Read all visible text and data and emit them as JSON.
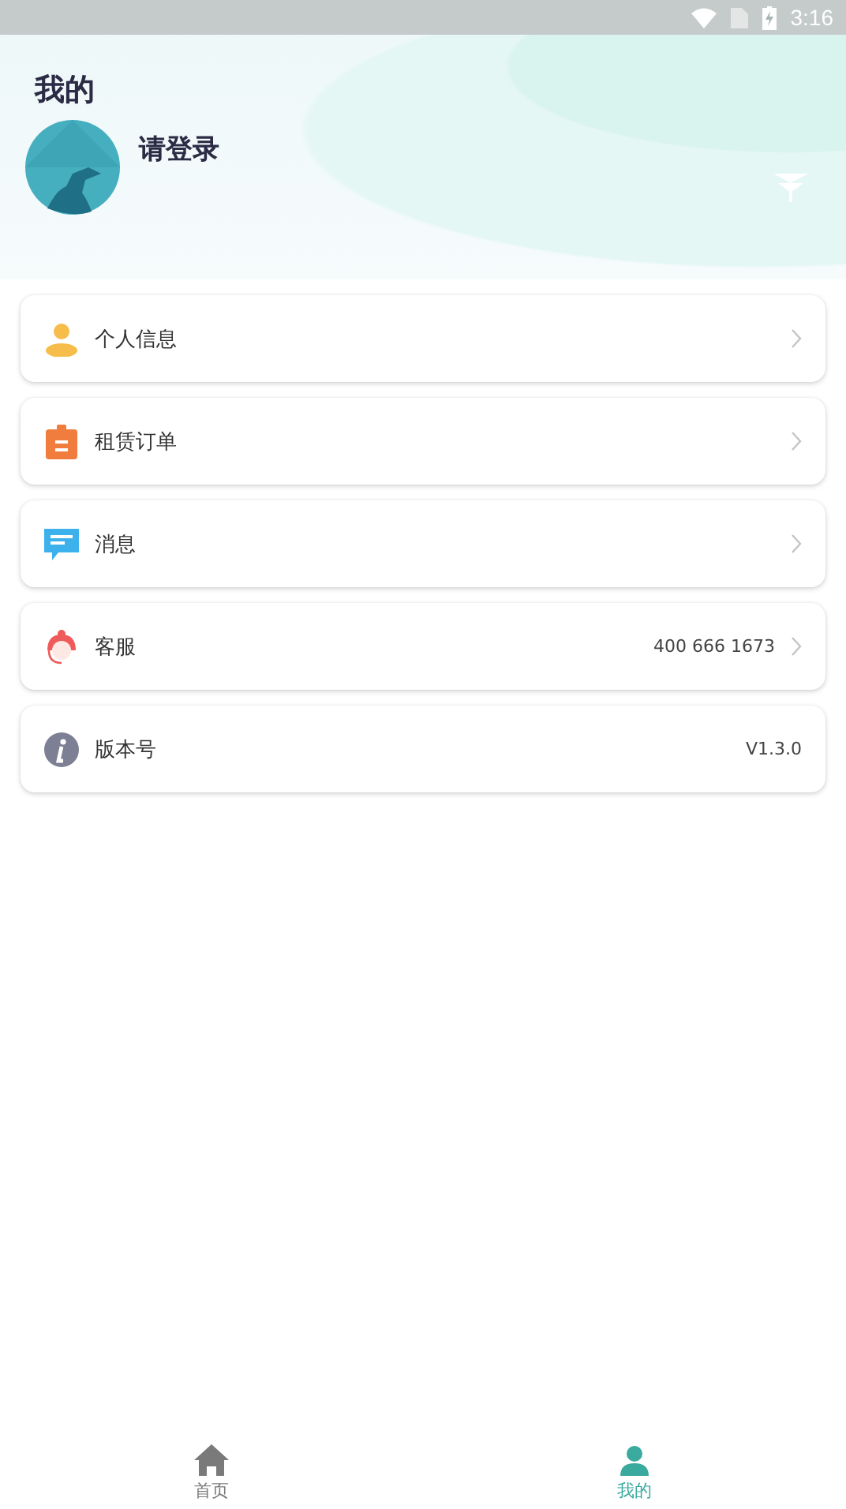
{
  "status_bar": {
    "time": "3:16"
  },
  "header": {
    "title": "我的",
    "login_prompt": "请登录"
  },
  "menu": [
    {
      "kind": "person",
      "label": "个人信息",
      "chevron": true
    },
    {
      "kind": "clipboard",
      "label": "租赁订单",
      "chevron": true
    },
    {
      "kind": "chat",
      "label": "消息",
      "chevron": true
    },
    {
      "kind": "agent",
      "label": "客服",
      "value": "400 666 1673",
      "chevron": true
    },
    {
      "kind": "info",
      "label": "版本号",
      "value": "V1.3.0",
      "chevron": false
    }
  ],
  "tabs": [
    {
      "kind": "home",
      "label": "首页",
      "selected": false
    },
    {
      "kind": "person",
      "label": "我的",
      "selected": true
    }
  ]
}
